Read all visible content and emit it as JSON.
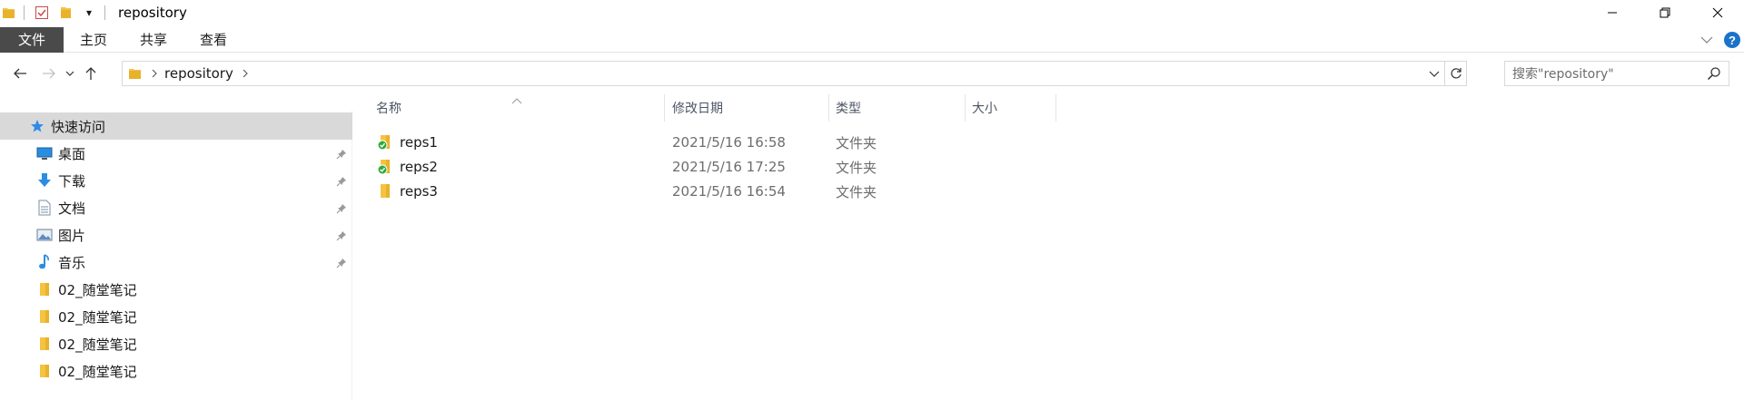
{
  "window": {
    "title": "repository",
    "qat_dropdown_glyph": "▾"
  },
  "ribbon": {
    "tabs": [
      {
        "label": "文件"
      },
      {
        "label": "主页"
      },
      {
        "label": "共享"
      },
      {
        "label": "查看"
      }
    ],
    "help_glyph": "?"
  },
  "navbar": {
    "breadcrumb": [
      "repository"
    ],
    "search_placeholder": "搜索\"repository\""
  },
  "sidebar": {
    "quick_access_label": "快速访问",
    "items": [
      {
        "label": "桌面",
        "icon": "desktop-icon",
        "pinned": true
      },
      {
        "label": "下载",
        "icon": "download-icon",
        "pinned": true
      },
      {
        "label": "文档",
        "icon": "documents-icon",
        "pinned": true
      },
      {
        "label": "图片",
        "icon": "pictures-icon",
        "pinned": true
      },
      {
        "label": "音乐",
        "icon": "music-icon",
        "pinned": true
      },
      {
        "label": "02_随堂笔记",
        "icon": "folder-icon",
        "pinned": false
      },
      {
        "label": "02_随堂笔记",
        "icon": "folder-icon",
        "pinned": false
      },
      {
        "label": "02_随堂笔记",
        "icon": "folder-icon",
        "pinned": false
      },
      {
        "label": "02_随堂笔记",
        "icon": "folder-icon",
        "pinned": false
      }
    ]
  },
  "columns": {
    "name": "名称",
    "date": "修改日期",
    "type": "类型",
    "size": "大小"
  },
  "files": [
    {
      "name": "reps1",
      "date": "2021/5/16 16:58",
      "type": "文件夹",
      "synced": true
    },
    {
      "name": "reps2",
      "date": "2021/5/16 17:25",
      "type": "文件夹",
      "synced": true
    },
    {
      "name": "reps3",
      "date": "2021/5/16 16:54",
      "type": "文件夹",
      "synced": false
    }
  ],
  "colors": {
    "accent": "#1a73c9",
    "folder": "#f5c342",
    "sync_green": "#2eab3a",
    "selected_bg": "#d9d9d9",
    "file_tab_bg": "#4a4a4a"
  }
}
